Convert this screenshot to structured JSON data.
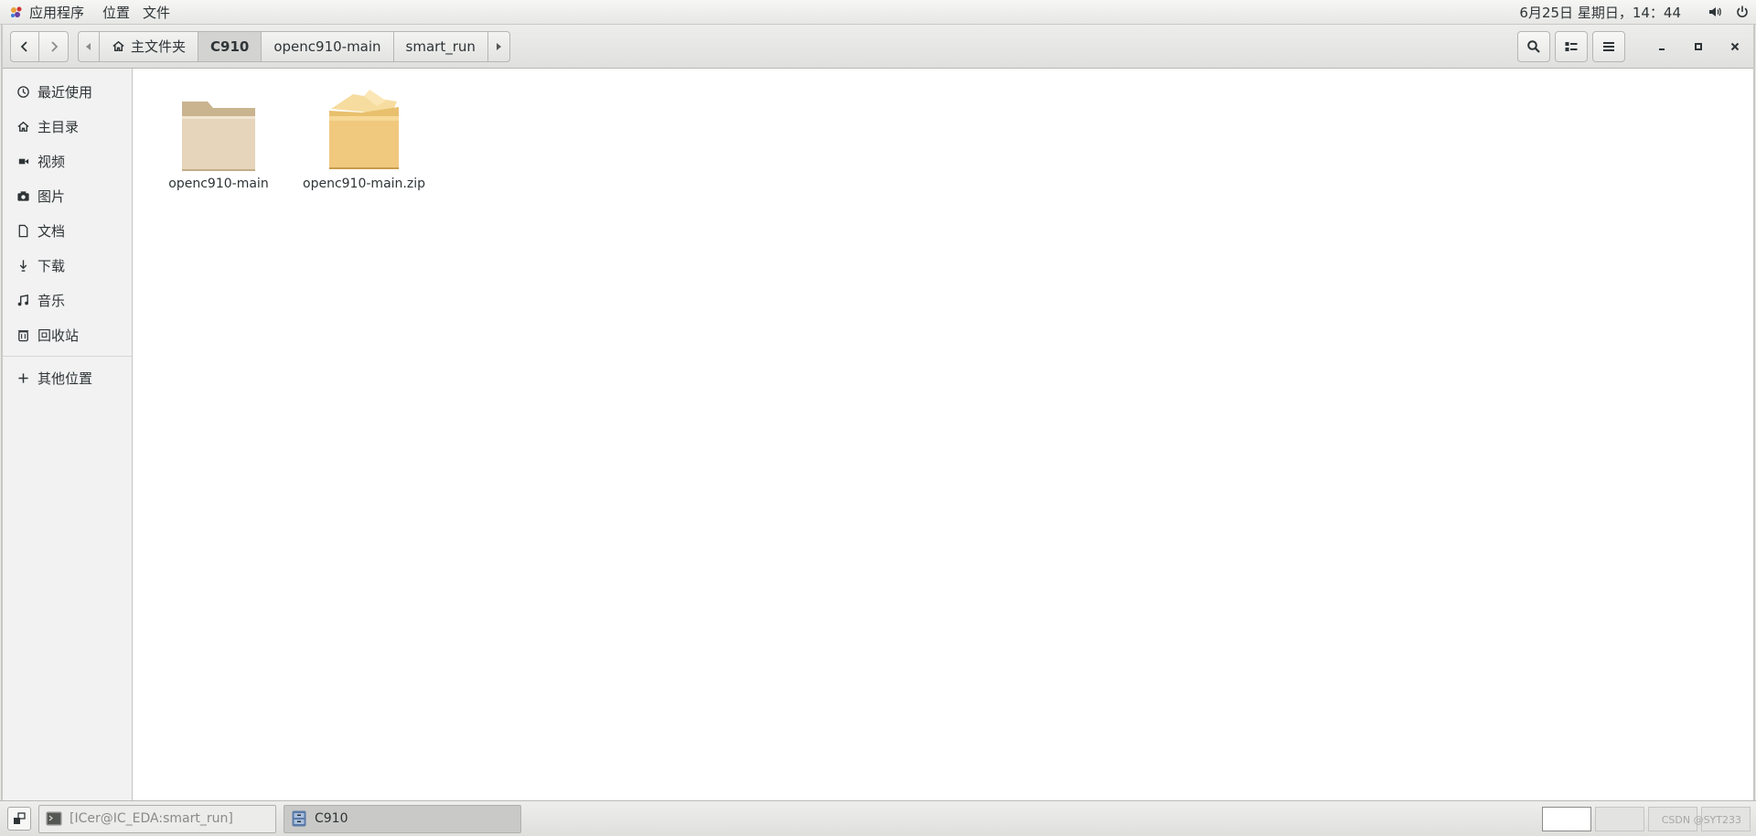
{
  "topbar": {
    "menu": [
      "应用程序",
      "位置",
      "文件"
    ],
    "clock": "6月25日 星期日，14：44",
    "tray": [
      "volume-icon",
      "power-icon"
    ]
  },
  "headerbar": {
    "nav": [
      "back-icon",
      "forward-icon"
    ],
    "path": [
      "主文件夹",
      "C910",
      "openc910-main",
      "smart_run"
    ],
    "current_path_index": 1,
    "tools": [
      "search-icon",
      "view-list-icon",
      "menu-icon"
    ],
    "window_controls": [
      "minimize-icon",
      "maximize-icon",
      "close-icon"
    ]
  },
  "sidebar": {
    "items": [
      {
        "label": "最近使用",
        "icon": "recent-icon"
      },
      {
        "label": "主目录",
        "icon": "home-icon"
      },
      {
        "label": "视频",
        "icon": "video-icon"
      },
      {
        "label": "图片",
        "icon": "camera-icon"
      },
      {
        "label": "文档",
        "icon": "document-icon"
      },
      {
        "label": "下载",
        "icon": "download-icon"
      },
      {
        "label": "音乐",
        "icon": "music-icon"
      },
      {
        "label": "回收站",
        "icon": "trash-icon"
      }
    ],
    "other": {
      "label": "其他位置",
      "icon": "plus-icon"
    }
  },
  "files": [
    {
      "name": "openc910-main",
      "type": "folder"
    },
    {
      "name": "openc910-main.zip",
      "type": "archive"
    }
  ],
  "taskbar": {
    "tasks": [
      {
        "label": "[ICer@IC_EDA:smart_run]",
        "active": false,
        "icon": "terminal-icon"
      },
      {
        "label": "C910",
        "active": true,
        "icon": "file-manager-icon"
      }
    ],
    "watermark": "CSDN @SYT233"
  },
  "colors": {
    "folder": "#e6d5bb",
    "folder_tab": "#c9b48f",
    "archive": "#f0c97e",
    "selected_path": "#d3d3d2"
  }
}
